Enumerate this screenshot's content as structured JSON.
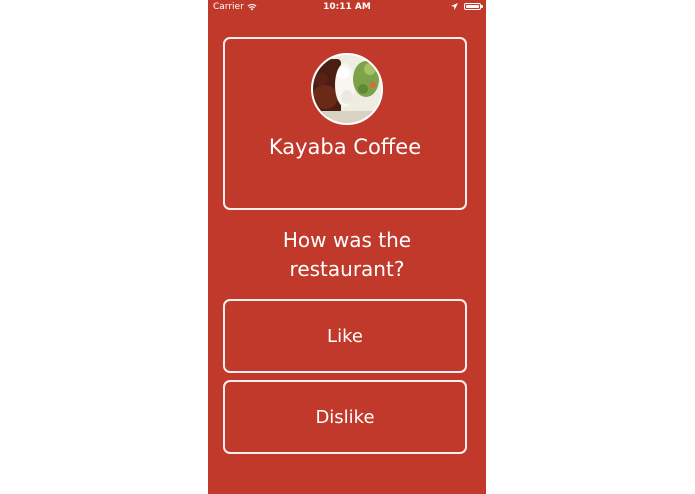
{
  "status_bar": {
    "carrier": "Carrier",
    "time": "10:11 AM",
    "wifi_icon": "wifi-icon",
    "location_icon": "location-arrow-icon",
    "battery_icon": "battery-icon"
  },
  "restaurant": {
    "name": "Kayaba Coffee",
    "photo_icon": "restaurant-photo"
  },
  "prompt": {
    "question_line1": "How was the",
    "question_line2": "restaurant?"
  },
  "actions": {
    "like_label": "Like",
    "dislike_label": "Dislike"
  },
  "colors": {
    "background": "#c0392b",
    "foreground": "#ffffff"
  }
}
